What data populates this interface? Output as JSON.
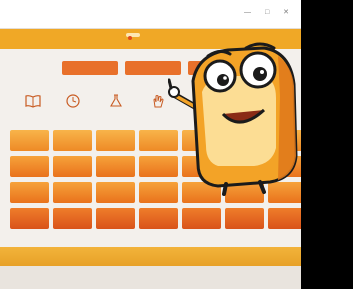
{
  "window": {
    "title": "",
    "controls": "— □ ✕"
  },
  "nav": {
    "tabs": [
      {
        "label": "",
        "active": false
      },
      {
        "label": "",
        "active": true
      },
      {
        "label": "",
        "active": false
      }
    ]
  },
  "actions": [
    {
      "label": ""
    },
    {
      "label": ""
    },
    {
      "label": ""
    }
  ],
  "tools": [
    {
      "icon": "book-icon",
      "label": ""
    },
    {
      "icon": "clock-icon",
      "label": ""
    },
    {
      "icon": "flask-icon",
      "label": ""
    },
    {
      "icon": "hand-icon",
      "label": ""
    }
  ],
  "grid": {
    "rows": 4,
    "cols": 7
  },
  "mascot": {
    "name": "",
    "icon": "mascot-character"
  },
  "colors": {
    "accent": "#f0a826",
    "button": "#e8702a",
    "tile_top": "#f6a23a",
    "tile_bottom": "#e9721c",
    "mascot_body": "#f3a327",
    "mascot_face": "#fde8a8"
  }
}
